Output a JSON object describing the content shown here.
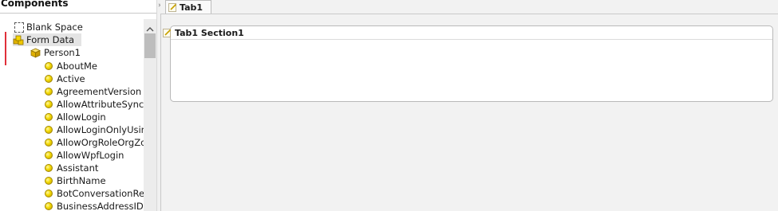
{
  "left_panel": {
    "title": "Components",
    "tree": [
      {
        "label": "Blank Space",
        "icon": "blank-space-icon"
      },
      {
        "label": "Form Data",
        "icon": "form-data-icon",
        "selected": true
      },
      {
        "label": "Person1",
        "icon": "cube-icon"
      },
      {
        "label": "AboutMe",
        "icon": "field-ball-icon"
      },
      {
        "label": "Active",
        "icon": "field-ball-icon"
      },
      {
        "label": "AgreementVersion",
        "icon": "field-ball-icon"
      },
      {
        "label": "AllowAttributeSync",
        "icon": "field-ball-icon"
      },
      {
        "label": "AllowLogin",
        "icon": "field-ball-icon"
      },
      {
        "label": "AllowLoginOnlyUsing",
        "icon": "field-ball-icon"
      },
      {
        "label": "AllowOrgRoleOrgZo",
        "icon": "field-ball-icon"
      },
      {
        "label": "AllowWpfLogin",
        "icon": "field-ball-icon"
      },
      {
        "label": "Assistant",
        "icon": "field-ball-icon"
      },
      {
        "label": "BirthName",
        "icon": "field-ball-icon"
      },
      {
        "label": "BotConversationRefe",
        "icon": "field-ball-icon"
      },
      {
        "label": "BusinessAddressID",
        "icon": "field-ball-icon"
      }
    ]
  },
  "tabs": [
    {
      "label": "Tab1",
      "active": true
    }
  ],
  "section": {
    "title": "Tab1 Section1"
  },
  "colors": {
    "marker": "#e0303a",
    "field_icon": "#f3d900"
  }
}
